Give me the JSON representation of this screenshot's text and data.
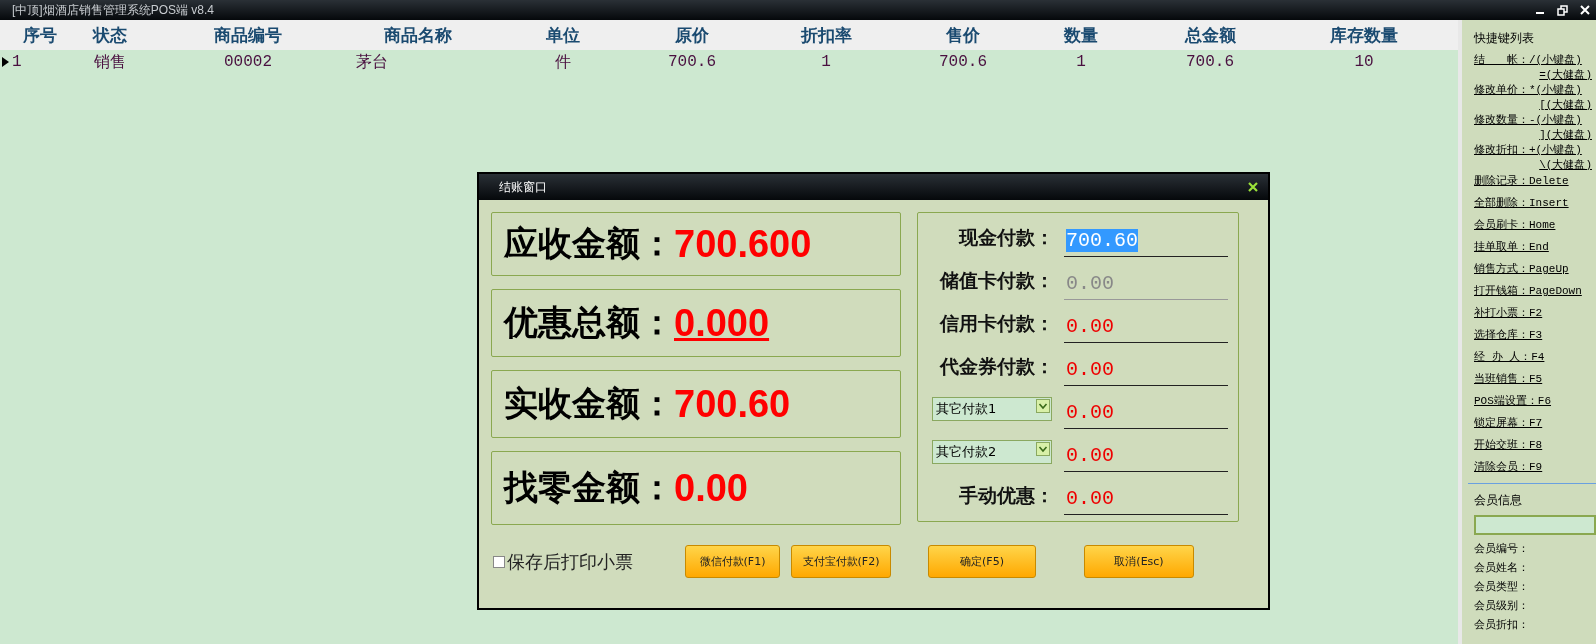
{
  "window": {
    "title": "[中顶]烟酒店销售管理系统POS端 v8.4"
  },
  "table": {
    "columns": [
      "序号",
      "状态",
      "商品编号",
      "商品名称",
      "单位",
      "原价",
      "折扣率",
      "售价",
      "数量",
      "总金额",
      "库存数量"
    ],
    "rows": [
      {
        "selected": true,
        "cells": [
          "1",
          "销售",
          "00002",
          "茅台",
          "件",
          "700.6",
          "1",
          "700.6",
          "1",
          "700.6",
          "10"
        ]
      }
    ]
  },
  "sidebar": {
    "title": "快捷键列表",
    "shortcuts": [
      {
        "lines": [
          "结　　帐：/(小键盘)",
          "=(大健盘)"
        ]
      },
      {
        "lines": [
          "修改单价：*(小键盘)",
          "[(大健盘)"
        ]
      },
      {
        "lines": [
          "修改数量：-(小键盘)",
          "](大健盘)"
        ]
      },
      {
        "lines": [
          "修改折扣：+(小键盘)",
          "\\(大健盘)"
        ]
      },
      {
        "lines": [
          "删除记录：Delete"
        ]
      },
      {
        "lines": [
          "全部删除：Insert"
        ]
      },
      {
        "lines": [
          "会员刷卡：Home"
        ]
      },
      {
        "lines": [
          "挂单取单：End"
        ]
      },
      {
        "lines": [
          "销售方式：PageUp"
        ]
      },
      {
        "lines": [
          "打开钱箱：PageDown"
        ]
      },
      {
        "lines": [
          "补打小票：F2"
        ]
      },
      {
        "lines": [
          "选择仓库：F3"
        ]
      },
      {
        "lines": [
          "经 办 人：F4"
        ]
      },
      {
        "lines": [
          "当班销售：F5"
        ]
      },
      {
        "lines": [
          "POS端设置：F6"
        ]
      },
      {
        "lines": [
          "锁定屏幕：F7"
        ]
      },
      {
        "lines": [
          "开始交班：F8"
        ]
      },
      {
        "lines": [
          "清除会员：F9"
        ]
      }
    ],
    "member_title": "会员信息",
    "member_fields": [
      "会员编号：",
      "会员姓名：",
      "会员类型：",
      "会员级别：",
      "会员折扣："
    ]
  },
  "dialog": {
    "title": "结账窗口",
    "amounts": [
      {
        "label": "应收金额：",
        "value": "700.600",
        "kind": "plain"
      },
      {
        "label": "优惠总额：",
        "value": "0.000",
        "kind": "link"
      },
      {
        "label": "实收金额：",
        "value": "700.60",
        "kind": "plain"
      },
      {
        "label": "找零金额：",
        "value": "0.00",
        "kind": "plain"
      }
    ],
    "payments": [
      {
        "kind": "label",
        "label": "现金付款：",
        "value": "700.60",
        "highlighted": true,
        "disabled": false
      },
      {
        "kind": "label",
        "label": "储值卡付款：",
        "value": "0.00",
        "highlighted": false,
        "disabled": true
      },
      {
        "kind": "label",
        "label": "信用卡付款：",
        "value": "0.00",
        "highlighted": false,
        "disabled": false
      },
      {
        "kind": "label",
        "label": "代金券付款：",
        "value": "0.00",
        "highlighted": false,
        "disabled": false
      },
      {
        "kind": "select",
        "label": "其它付款1",
        "value": "0.00",
        "highlighted": false,
        "disabled": false
      },
      {
        "kind": "select",
        "label": "其它付款2",
        "value": "0.00",
        "highlighted": false,
        "disabled": false
      },
      {
        "kind": "label",
        "label": "手动优惠：",
        "value": "0.00",
        "highlighted": false,
        "disabled": false
      }
    ],
    "print_receipt": {
      "label": "保存后打印小票",
      "checked": false
    },
    "buttons": [
      "微信付款(F1)",
      "支付宝付款(F2)",
      "确定(F5)",
      "取消(Esc)"
    ]
  }
}
